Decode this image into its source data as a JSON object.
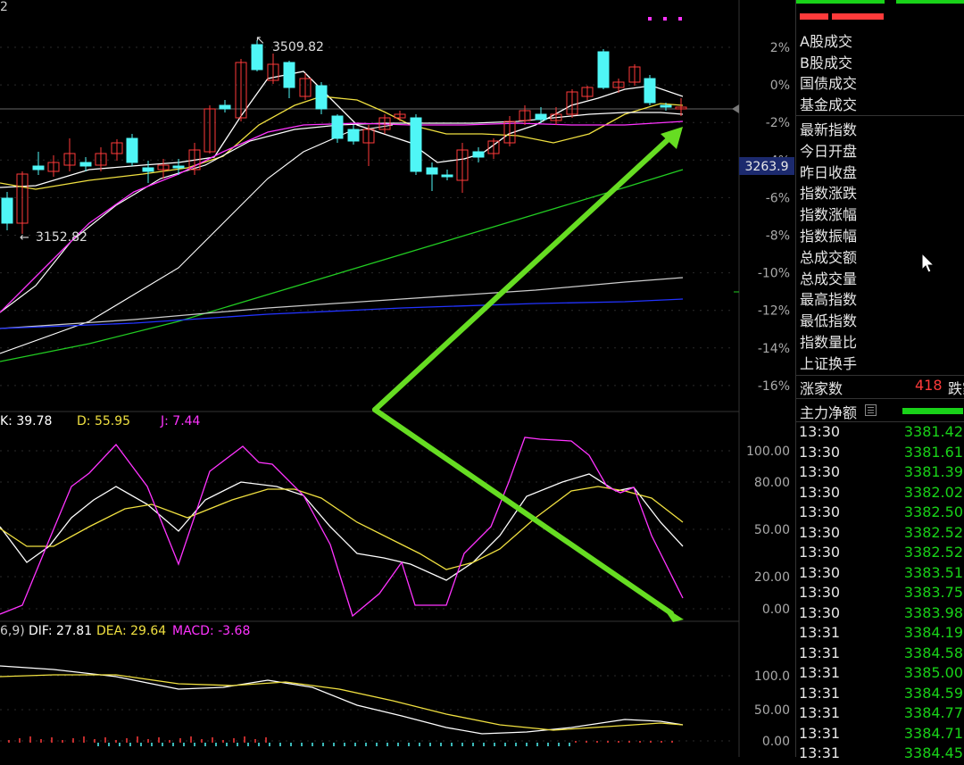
{
  "window": {
    "corner_label": "2"
  },
  "price_axis": {
    "labels": [
      "2%",
      "0%",
      "-2%",
      "-4%",
      "-6%",
      "-8%",
      "-10%",
      "-12%",
      "-14%",
      "-16%"
    ],
    "current_price_badge": "3263.9",
    "high_label": "3509.82",
    "low_label": "3152.82"
  },
  "kdj": {
    "k_label": "K: 39.78",
    "d_label": "D: 55.95",
    "j_label": "J: 7.44",
    "axis": [
      "100.00",
      "80.00",
      "50.00",
      "20.00",
      "0.00"
    ]
  },
  "macd": {
    "params_label": "6,9)",
    "dif_label": "DIF: 27.81",
    "dea_label": "DEA: 29.64",
    "macd_label": "MACD: -3.68",
    "axis": [
      "100.0",
      "50.00",
      "0.00"
    ]
  },
  "colors": {
    "up": "#ff3a3a",
    "down": "#4ff6f6",
    "ma5": "#ffffff",
    "ma10": "#f0e040",
    "ma20": "#ff33ff",
    "ma60": "#22cc22",
    "ma120": "#cccccc",
    "ma250": "#2233ff",
    "arrow": "#66dd22",
    "panel_green": "#19d219",
    "panel_red": "#ff3a3a"
  },
  "panel": {
    "menu_items": [
      "A股成交",
      "B股成交",
      "国债成交",
      "基金成交"
    ],
    "field_items": [
      "最新指数",
      "今日开盘",
      "昨日收盘",
      "指数涨跌",
      "指数涨幅",
      "指数振幅",
      "总成交额",
      "总成交量",
      "最高指数",
      "最低指数",
      "指数量比",
      "上证换手"
    ],
    "advancers_label": "涨家数",
    "advancers_value": "418",
    "decliners_label": "跌家",
    "main_fund_label": "主力净额",
    "ticks": [
      {
        "time": "13:30",
        "price": "3381.42"
      },
      {
        "time": "13:30",
        "price": "3381.61"
      },
      {
        "time": "13:30",
        "price": "3381.39"
      },
      {
        "time": "13:30",
        "price": "3382.02"
      },
      {
        "time": "13:30",
        "price": "3382.50"
      },
      {
        "time": "13:30",
        "price": "3382.52"
      },
      {
        "time": "13:30",
        "price": "3382.52"
      },
      {
        "time": "13:30",
        "price": "3383.51"
      },
      {
        "time": "13:30",
        "price": "3383.75"
      },
      {
        "time": "13:30",
        "price": "3383.98"
      },
      {
        "time": "13:31",
        "price": "3384.19"
      },
      {
        "time": "13:31",
        "price": "3384.58"
      },
      {
        "time": "13:31",
        "price": "3385.00"
      },
      {
        "time": "13:31",
        "price": "3384.59"
      },
      {
        "time": "13:31",
        "price": "3384.77"
      },
      {
        "time": "13:31",
        "price": "3384.71"
      },
      {
        "time": "13:31",
        "price": "3384.45"
      }
    ]
  }
}
